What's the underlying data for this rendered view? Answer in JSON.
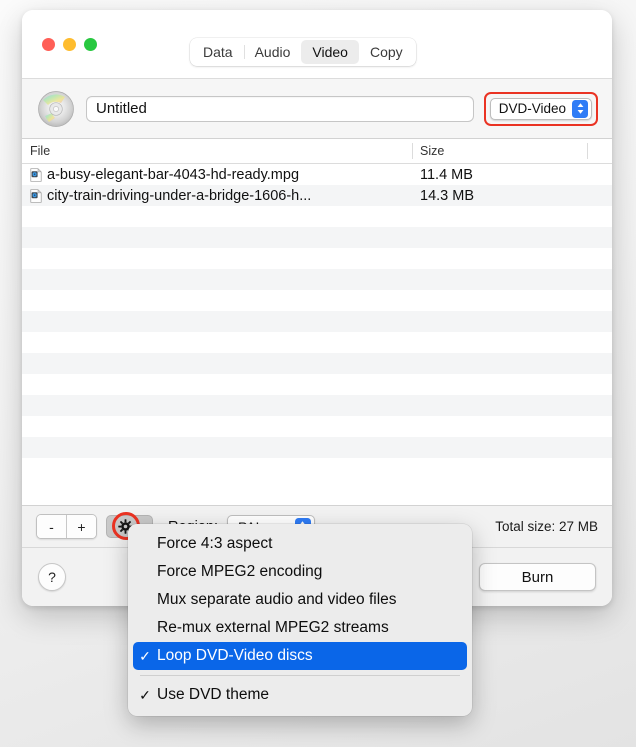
{
  "window": {
    "traffic_lights": [
      {
        "name": "close",
        "color": "#ff5f57"
      },
      {
        "name": "minimize",
        "color": "#febc2e"
      },
      {
        "name": "zoom",
        "color": "#28c840"
      }
    ],
    "tabs": [
      {
        "label": "Data",
        "selected": false
      },
      {
        "label": "Audio",
        "selected": false
      },
      {
        "label": "Video",
        "selected": true
      },
      {
        "label": "Copy",
        "selected": false
      }
    ]
  },
  "name_row": {
    "disc_icon": "cd-disc-icon",
    "title_value": "Untitled",
    "title_placeholder": "Untitled",
    "format_popup": {
      "value": "DVD-Video",
      "highlight_color": "#ea3323"
    }
  },
  "table": {
    "columns": [
      "File",
      "Size"
    ],
    "rows": [
      {
        "icon": "movie-file-icon",
        "file": "a-busy-elegant-bar-4043-hd-ready.mpg",
        "size": "11.4 MB"
      },
      {
        "icon": "movie-file-icon",
        "file": "city-train-driving-under-a-bridge-1606-h...",
        "size": "14.3 MB"
      }
    ],
    "empty_row_count": 12
  },
  "control_bar": {
    "remove_label": "-",
    "add_label": "+",
    "gear_icon": "gear-icon",
    "gear_highlight_color": "#ea3323",
    "region_label": "Region:",
    "region_value": "PAL",
    "total_size": "Total size: 27 MB"
  },
  "footer": {
    "help_label": "?",
    "burn_label": "Burn"
  },
  "menu": {
    "items": [
      {
        "label": "Force 4:3 aspect",
        "checked": false,
        "selected": false
      },
      {
        "label": "Force MPEG2 encoding",
        "checked": false,
        "selected": false
      },
      {
        "label": "Mux separate audio and video files",
        "checked": false,
        "selected": false
      },
      {
        "label": "Re-mux external MPEG2 streams",
        "checked": false,
        "selected": false
      },
      {
        "label": "Loop DVD-Video discs",
        "checked": true,
        "selected": true
      },
      {
        "separator": true
      },
      {
        "label": "Use DVD theme",
        "checked": true,
        "selected": false
      }
    ],
    "check_glyph": "✓",
    "highlight_color": "#0a66e8"
  }
}
